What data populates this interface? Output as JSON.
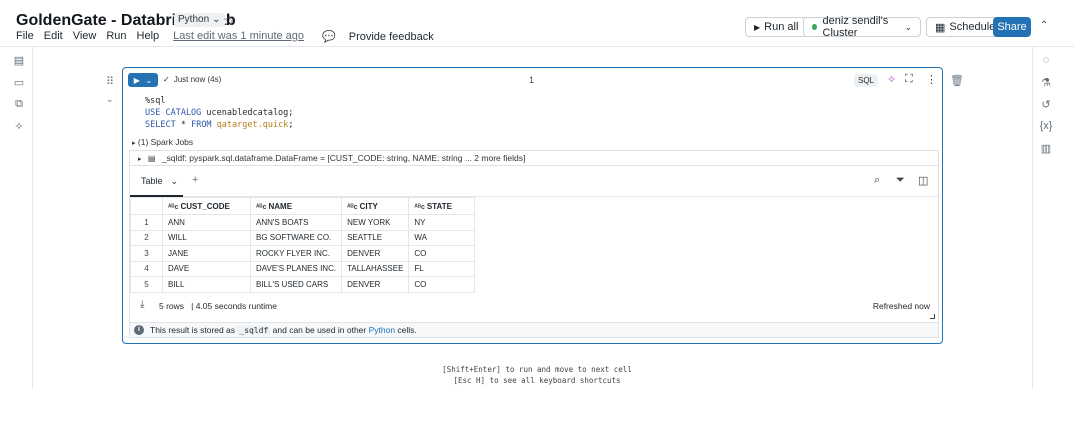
{
  "header": {
    "title": "GoldenGate - Databricks Lab",
    "language": "Python",
    "menu": [
      "File",
      "Edit",
      "View",
      "Run",
      "Help"
    ],
    "last_edit": "Last edit was 1 minute ago",
    "feedback": "Provide feedback",
    "run_all": "Run all",
    "cluster": "deniz sendil's Cluster",
    "schedule": "Schedule",
    "share": "Share",
    "colors": {
      "primary": "#2272b4",
      "cluster_status": "#3ba55c"
    }
  },
  "cell": {
    "status": "Just now (4s)",
    "number": "1",
    "language": "SQL",
    "code": {
      "line1": "%sql",
      "line2_kw": "USE CATALOG",
      "line2_rest": " ucenabledcatalog;",
      "line3_kw1": "SELECT",
      "line3_mid": " * ",
      "line3_kw2": "FROM",
      "line3_space": " ",
      "line3_tbl": "qatarget.quick",
      "line3_end": ";"
    },
    "spark_jobs": "(1) Spark Jobs",
    "dataframe": "_sqldf:  pyspark.sql.dataframe.DataFrame = [CUST_CODE: string, NAME: string ... 2 more fields]"
  },
  "results": {
    "tab": "Table",
    "columns": [
      "CUST_CODE",
      "NAME",
      "CITY",
      "STATE"
    ],
    "column_type_icon": "A B C",
    "rows": [
      [
        "1",
        "ANN",
        "ANN'S BOATS",
        "NEW YORK",
        "NY"
      ],
      [
        "2",
        "WILL",
        "BG SOFTWARE CO.",
        "SEATTLE",
        "WA"
      ],
      [
        "3",
        "JANE",
        "ROCKY FLYER INC.",
        "DENVER",
        "CO"
      ],
      [
        "4",
        "DAVE",
        "DAVE'S PLANES INC.",
        "TALLAHASSEE",
        "FL"
      ],
      [
        "5",
        "BILL",
        "BILL'S USED CARS",
        "DENVER",
        "CO"
      ]
    ],
    "row_count": "5 rows",
    "runtime": "|  4.05 seconds runtime",
    "refreshed": "Refreshed now",
    "info_prefix": "This result is stored as ",
    "info_var": "_sqldf",
    "info_mid": " and can be used in other ",
    "info_link": "Python",
    "info_end": " cells."
  },
  "hints": {
    "line1": "[Shift+Enter] to run and move to next cell",
    "line2": "[Esc H] to see all keyboard shortcuts"
  }
}
